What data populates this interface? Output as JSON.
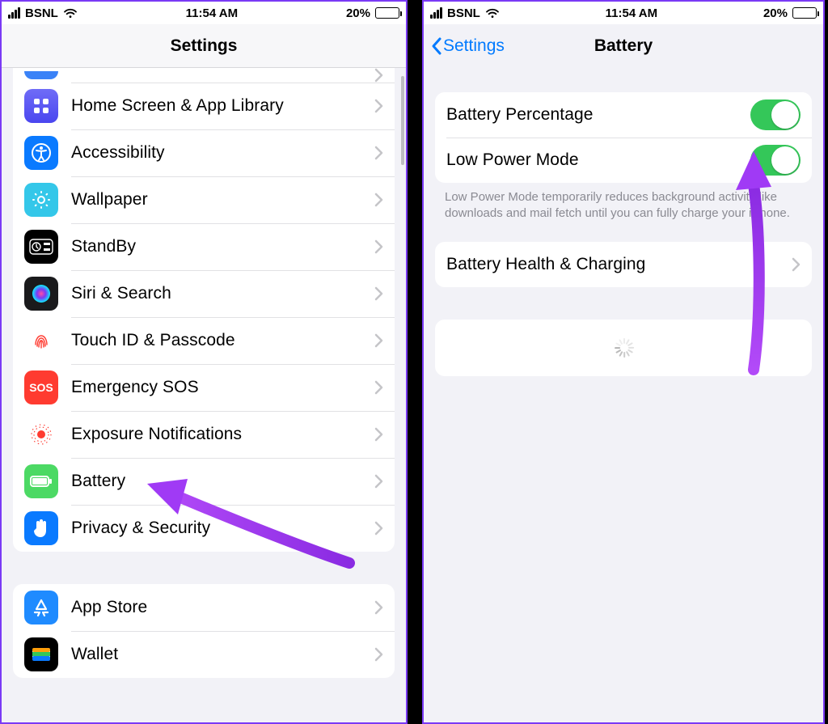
{
  "status": {
    "carrier": "BSNL",
    "time": "11:54 AM",
    "battery_pct": "20%"
  },
  "left": {
    "title": "Settings",
    "group1": {
      "items": [
        {
          "label": ""
        },
        {
          "label": "Home Screen & App Library"
        },
        {
          "label": "Accessibility"
        },
        {
          "label": "Wallpaper"
        },
        {
          "label": "StandBy"
        },
        {
          "label": "Siri & Search"
        },
        {
          "label": "Touch ID & Passcode"
        },
        {
          "label": "Emergency SOS"
        },
        {
          "label": "Exposure Notifications"
        },
        {
          "label": "Battery"
        },
        {
          "label": "Privacy & Security"
        }
      ]
    },
    "group2": {
      "items": [
        {
          "label": "App Store"
        },
        {
          "label": "Wallet"
        }
      ]
    }
  },
  "right": {
    "back": "Settings",
    "title": "Battery",
    "rows": {
      "pct": {
        "label": "Battery Percentage"
      },
      "lpm": {
        "label": "Low Power Mode"
      },
      "health": {
        "label": "Battery Health & Charging"
      }
    },
    "lpm_footnote": "Low Power Mode temporarily reduces background activity like downloads and mail fetch until you can fully charge your iPhone."
  },
  "sos_text": "SOS"
}
